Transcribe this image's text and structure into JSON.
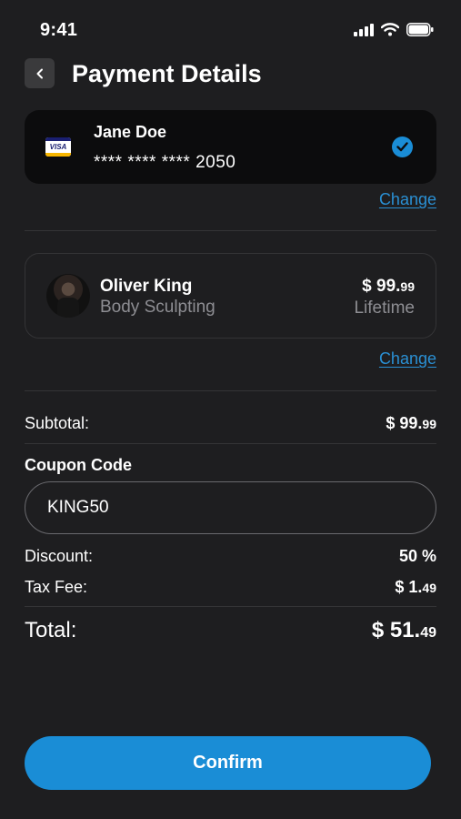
{
  "status_bar": {
    "time": "9:41"
  },
  "header": {
    "title": "Payment Details"
  },
  "card": {
    "brand": "VISA",
    "holder": "Jane Doe",
    "number": "**** **** **** 2050",
    "change_label": "Change"
  },
  "plan": {
    "trainer": "Oliver King",
    "program": "Body Sculpting",
    "price_main": "$ 99.",
    "price_cents": "99",
    "term": "Lifetime",
    "change_label": "Change"
  },
  "summary": {
    "subtotal_label": "Subtotal:",
    "subtotal_main": "$ 99.",
    "subtotal_cents": "99",
    "coupon_heading": "Coupon Code",
    "coupon_value": "KING50",
    "discount_label": "Discount:",
    "discount_value": "50 %",
    "tax_label": "Tax Fee:",
    "tax_main": "$ 1.",
    "tax_cents": "49",
    "total_label": "Total:",
    "total_main": "$ 51.",
    "total_cents": "49"
  },
  "actions": {
    "confirm_label": "Confirm"
  },
  "colors": {
    "accent": "#1a8dd6",
    "background": "#1e1e20",
    "card": "#0c0c0d",
    "muted": "#8e8e93"
  }
}
